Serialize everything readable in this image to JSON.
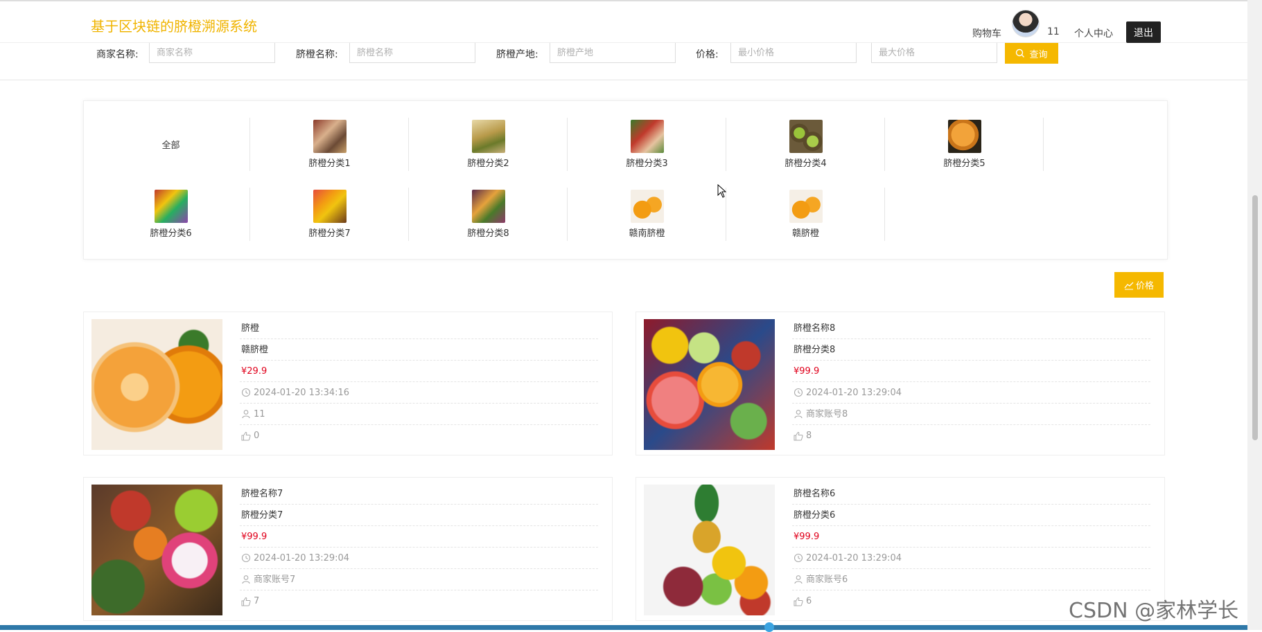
{
  "header": {
    "title": "基于区块链的脐橙溯源系统",
    "cart": "购物车",
    "username": "11",
    "profile": "个人中心",
    "logout": "退出"
  },
  "search": {
    "merchant_label": "商家名称:",
    "merchant_placeholder": "商家名称",
    "name_label": "脐橙名称:",
    "name_placeholder": "脐橙名称",
    "origin_label": "脐橙产地:",
    "origin_placeholder": "脐橙产地",
    "price_label": "价格:",
    "min_placeholder": "最小价格",
    "max_placeholder": "最大价格",
    "query": "查询"
  },
  "categories": [
    {
      "label": "全部"
    },
    {
      "label": "脐橙分类1"
    },
    {
      "label": "脐橙分类2"
    },
    {
      "label": "脐橙分类3"
    },
    {
      "label": "脐橙分类4"
    },
    {
      "label": "脐橙分类5"
    },
    {
      "label": "脐橙分类6"
    },
    {
      "label": "脐橙分类7"
    },
    {
      "label": "脐橙分类8"
    },
    {
      "label": "赣南脐橙"
    },
    {
      "label": "赣脐橙"
    }
  ],
  "sort_button": "价格",
  "products": [
    {
      "name": "脐橙",
      "category": "赣脐橙",
      "price": "¥29.9",
      "time": "2024-01-20 13:34:16",
      "merchant": "11",
      "likes": "0"
    },
    {
      "name": "脐橙名称8",
      "category": "脐橙分类8",
      "price": "¥99.9",
      "time": "2024-01-20 13:29:04",
      "merchant": "商家账号8",
      "likes": "8"
    },
    {
      "name": "脐橙名称7",
      "category": "脐橙分类7",
      "price": "¥99.9",
      "time": "2024-01-20 13:29:04",
      "merchant": "商家账号7",
      "likes": "7"
    },
    {
      "name": "脐橙名称6",
      "category": "脐橙分类6",
      "price": "¥99.9",
      "time": "2024-01-20 13:29:04",
      "merchant": "商家账号6",
      "likes": "6"
    }
  ],
  "watermark": "CSDN @家林学长",
  "colors": {
    "accent": "#f5b800",
    "title": "#f0b400",
    "price": "#e0001b"
  }
}
